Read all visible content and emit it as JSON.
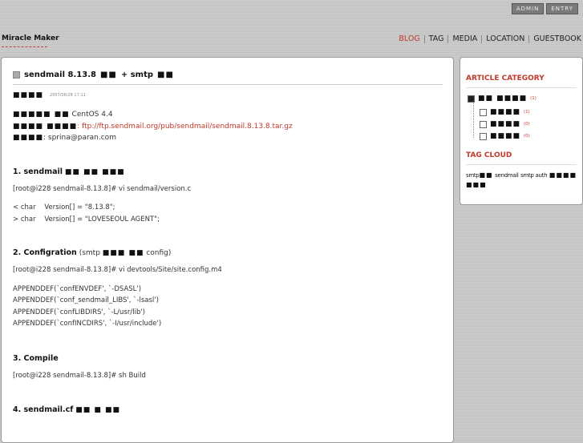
{
  "topbar": {
    "admin": "ADMIN",
    "entry": "ENTRY"
  },
  "site": {
    "title": "Miracle Maker"
  },
  "nav": [
    "BLOG",
    "TAG",
    "MEDIA",
    "LOCATION",
    "GUESTBOOK"
  ],
  "post": {
    "title_a": "sendmail 8.13.8",
    "title_b": "■■",
    "title_c": "+ smtp",
    "title_d": "■■",
    "author": "■■■■",
    "date": "2007/06/28 17:11",
    "info": [
      {
        "key": "■■■■■ ■■",
        "value": "CentOS 4.4",
        "link": ""
      },
      {
        "key": "■■■■ ■■■■",
        "value": ": ",
        "link": "ftp://ftp.sendmail.org/pub/sendmail/sendmail.8.13.8.tar.gz"
      },
      {
        "key": "■■■■",
        "value": ": sprina@paran.com",
        "link": ""
      }
    ],
    "s1_title": "1. sendmail",
    "s1_blocks": "■■ ■■ ■■■",
    "s1_cmd": "[root@i228 sendmail-8.13.8]# vi sendmail/version.c",
    "s1_line1": "< char    Version[] = \"8.13.8\";",
    "s1_line2": "> char    Version[] = \"LOVESEOUL AGENT\";",
    "s2_title": "2. Configration",
    "s2_pre": "(smtp",
    "s2_blocks": "■■■ ■■",
    "s2_post": "config)",
    "s2_cmd": "[root@i228 sendmail-8.13.8]# vi devtools/Site/site.config.m4",
    "s2_lines": [
      "APPENDDEF(`confENVDEF', `-DSASL')",
      "APPENDDEF(`conf_sendmail_LIBS', `-lsasl')",
      "APPENDDEF(`confLIBDIRS', `-L/usr/lib')",
      "APPENDDEF(`confINCDIRS', `-I/usr/include')"
    ],
    "s3_title": "3. Compile",
    "s3_cmd": "[root@i228 sendmail-8.13.8]# sh Build",
    "s4_title": "4. sendmail.cf",
    "s4_blocks": "■■ ■ ■■"
  },
  "sidebar": {
    "category_head": "ARTICLE CATEGORY",
    "categories": [
      {
        "label": "■■ ■■■■",
        "count": "(1)"
      },
      {
        "label": "■■■■",
        "count": "(1)"
      },
      {
        "label": "■■■■",
        "count": "(0)"
      },
      {
        "label": "■■■■",
        "count": "(0)"
      }
    ],
    "tag_head": "TAG CLOUD",
    "tags": {
      "smtp": "smtp",
      "smtp_blk": "■■",
      "sendmail": "sendmail",
      "smtpauth": "smtp auth",
      "end_blk": "■■■■ ■■■"
    }
  },
  "colors": {
    "accent": "#c0392b",
    "background": "#c9c9c9"
  }
}
